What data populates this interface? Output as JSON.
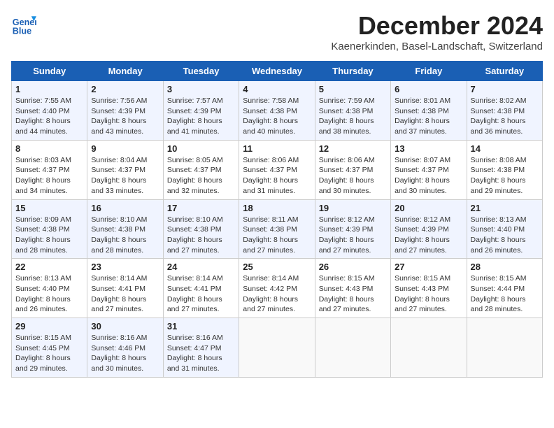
{
  "header": {
    "logo_text_general": "General",
    "logo_text_blue": "Blue",
    "month": "December 2024",
    "location": "Kaenerkinden, Basel-Landschaft, Switzerland"
  },
  "weekdays": [
    "Sunday",
    "Monday",
    "Tuesday",
    "Wednesday",
    "Thursday",
    "Friday",
    "Saturday"
  ],
  "weeks": [
    [
      {
        "day": "1",
        "sunrise": "7:55 AM",
        "sunset": "4:40 PM",
        "daylight": "8 hours and 44 minutes."
      },
      {
        "day": "2",
        "sunrise": "7:56 AM",
        "sunset": "4:39 PM",
        "daylight": "8 hours and 43 minutes."
      },
      {
        "day": "3",
        "sunrise": "7:57 AM",
        "sunset": "4:39 PM",
        "daylight": "8 hours and 41 minutes."
      },
      {
        "day": "4",
        "sunrise": "7:58 AM",
        "sunset": "4:38 PM",
        "daylight": "8 hours and 40 minutes."
      },
      {
        "day": "5",
        "sunrise": "7:59 AM",
        "sunset": "4:38 PM",
        "daylight": "8 hours and 38 minutes."
      },
      {
        "day": "6",
        "sunrise": "8:01 AM",
        "sunset": "4:38 PM",
        "daylight": "8 hours and 37 minutes."
      },
      {
        "day": "7",
        "sunrise": "8:02 AM",
        "sunset": "4:38 PM",
        "daylight": "8 hours and 36 minutes."
      }
    ],
    [
      {
        "day": "8",
        "sunrise": "8:03 AM",
        "sunset": "4:37 PM",
        "daylight": "8 hours and 34 minutes."
      },
      {
        "day": "9",
        "sunrise": "8:04 AM",
        "sunset": "4:37 PM",
        "daylight": "8 hours and 33 minutes."
      },
      {
        "day": "10",
        "sunrise": "8:05 AM",
        "sunset": "4:37 PM",
        "daylight": "8 hours and 32 minutes."
      },
      {
        "day": "11",
        "sunrise": "8:06 AM",
        "sunset": "4:37 PM",
        "daylight": "8 hours and 31 minutes."
      },
      {
        "day": "12",
        "sunrise": "8:06 AM",
        "sunset": "4:37 PM",
        "daylight": "8 hours and 30 minutes."
      },
      {
        "day": "13",
        "sunrise": "8:07 AM",
        "sunset": "4:37 PM",
        "daylight": "8 hours and 30 minutes."
      },
      {
        "day": "14",
        "sunrise": "8:08 AM",
        "sunset": "4:38 PM",
        "daylight": "8 hours and 29 minutes."
      }
    ],
    [
      {
        "day": "15",
        "sunrise": "8:09 AM",
        "sunset": "4:38 PM",
        "daylight": "8 hours and 28 minutes."
      },
      {
        "day": "16",
        "sunrise": "8:10 AM",
        "sunset": "4:38 PM",
        "daylight": "8 hours and 28 minutes."
      },
      {
        "day": "17",
        "sunrise": "8:10 AM",
        "sunset": "4:38 PM",
        "daylight": "8 hours and 27 minutes."
      },
      {
        "day": "18",
        "sunrise": "8:11 AM",
        "sunset": "4:38 PM",
        "daylight": "8 hours and 27 minutes."
      },
      {
        "day": "19",
        "sunrise": "8:12 AM",
        "sunset": "4:39 PM",
        "daylight": "8 hours and 27 minutes."
      },
      {
        "day": "20",
        "sunrise": "8:12 AM",
        "sunset": "4:39 PM",
        "daylight": "8 hours and 27 minutes."
      },
      {
        "day": "21",
        "sunrise": "8:13 AM",
        "sunset": "4:40 PM",
        "daylight": "8 hours and 26 minutes."
      }
    ],
    [
      {
        "day": "22",
        "sunrise": "8:13 AM",
        "sunset": "4:40 PM",
        "daylight": "8 hours and 26 minutes."
      },
      {
        "day": "23",
        "sunrise": "8:14 AM",
        "sunset": "4:41 PM",
        "daylight": "8 hours and 27 minutes."
      },
      {
        "day": "24",
        "sunrise": "8:14 AM",
        "sunset": "4:41 PM",
        "daylight": "8 hours and 27 minutes."
      },
      {
        "day": "25",
        "sunrise": "8:14 AM",
        "sunset": "4:42 PM",
        "daylight": "8 hours and 27 minutes."
      },
      {
        "day": "26",
        "sunrise": "8:15 AM",
        "sunset": "4:43 PM",
        "daylight": "8 hours and 27 minutes."
      },
      {
        "day": "27",
        "sunrise": "8:15 AM",
        "sunset": "4:43 PM",
        "daylight": "8 hours and 27 minutes."
      },
      {
        "day": "28",
        "sunrise": "8:15 AM",
        "sunset": "4:44 PM",
        "daylight": "8 hours and 28 minutes."
      }
    ],
    [
      {
        "day": "29",
        "sunrise": "8:15 AM",
        "sunset": "4:45 PM",
        "daylight": "8 hours and 29 minutes."
      },
      {
        "day": "30",
        "sunrise": "8:16 AM",
        "sunset": "4:46 PM",
        "daylight": "8 hours and 30 minutes."
      },
      {
        "day": "31",
        "sunrise": "8:16 AM",
        "sunset": "4:47 PM",
        "daylight": "8 hours and 31 minutes."
      },
      null,
      null,
      null,
      null
    ]
  ]
}
